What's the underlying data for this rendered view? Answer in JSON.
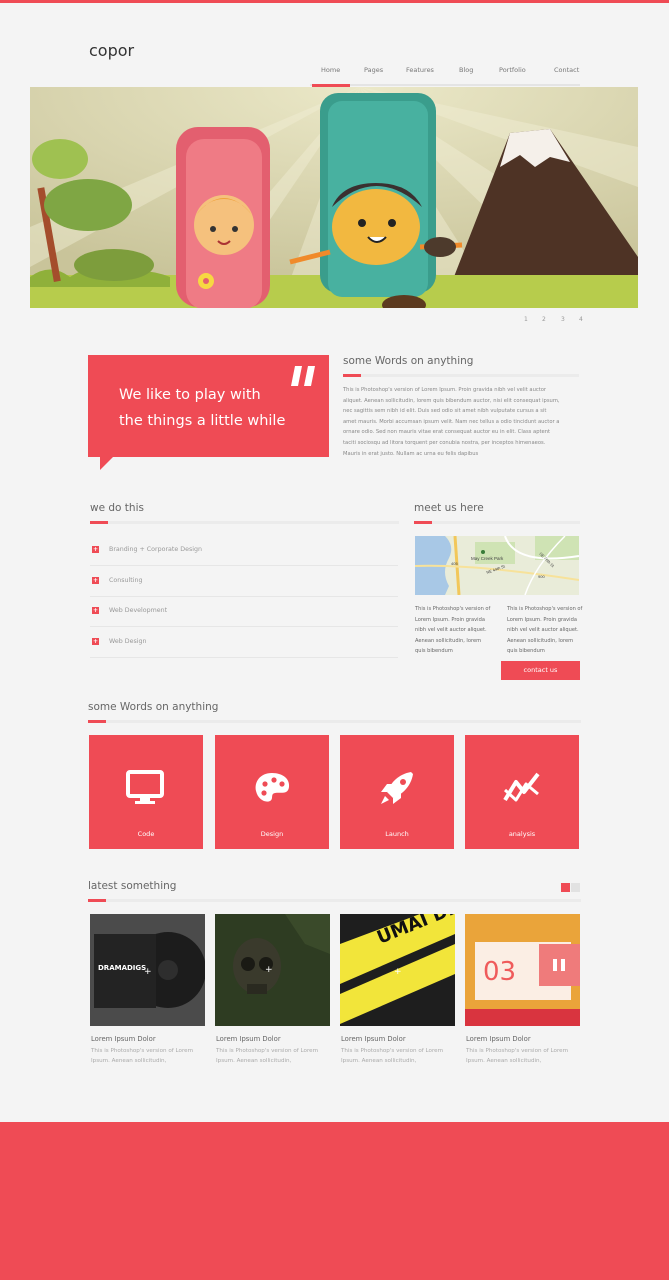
{
  "site": {
    "logo": "copor"
  },
  "nav": {
    "items": [
      "Home",
      "Pages",
      "Features",
      "Blog",
      "Portfolio",
      "Contact"
    ]
  },
  "hero": {
    "pager": [
      "1",
      "2",
      "3",
      "4"
    ]
  },
  "quote": {
    "line1": "We like to play with",
    "line2": "the things a little while"
  },
  "about": {
    "title": "some Words on anything",
    "text": "This is Photoshop's version  of Lorem Ipsum. Proin gravida nibh vel velit auctor aliquet. Aenean sollicitudin, lorem quis bibendum auctor, nisi elit consequat ipsum, nec sagittis sem nibh id elit. Duis sed odio sit amet nibh vulputate cursus a sit amet mauris. Morbi accumsan ipsum velit. Nam nec tellus a odio tincidunt auctor a ornare odio. Sed non  mauris vitae erat consequat auctor eu in elit. Class aptent taciti sociosqu ad litora torquent per conubia nostra, per inceptos himenaeos. Mauris in erat justo. Nullam ac urna eu felis dapibus"
  },
  "services": {
    "title": "we do this",
    "items": [
      "Branding + Corporate Design",
      "Consulting",
      "Web Development",
      "Web Design"
    ]
  },
  "meet": {
    "title": "meet us here",
    "map_labels": [
      "May Creek Park",
      "900",
      "405",
      "NE 44th St",
      "SE 76th St"
    ],
    "col1": "This is Photoshop's version  of Lorem Ipsum. Proin gravida nibh vel velit auctor aliquet. Aenean sollicitudin, lorem quis bibendum",
    "col2": "This is Photoshop's version  of Lorem Ipsum. Proin gravida nibh vel velit auctor aliquet. Aenean sollicitudin, lorem quis bibendum",
    "button": "contact us"
  },
  "features": {
    "title": "some Words on anything",
    "tiles": [
      {
        "label": "Code",
        "icon": "monitor-icon"
      },
      {
        "label": "Design",
        "icon": "palette-icon"
      },
      {
        "label": "Launch",
        "icon": "rocket-icon"
      },
      {
        "label": "analysis",
        "icon": "chart-icon"
      }
    ]
  },
  "latest": {
    "title": "latest something",
    "items": [
      {
        "title": "Lorem Ipsum Dolor",
        "desc": "This is Photoshop's version  of Lorem Ipsum. Aenean sollicitudin,",
        "image_text": "DRAMADIGS"
      },
      {
        "title": "Lorem Ipsum Dolor",
        "desc": "This is Photoshop's version  of Lorem Ipsum. Aenean sollicitudin,",
        "image_text": ""
      },
      {
        "title": "Lorem Ipsum Dolor",
        "desc": "This is Photoshop's version  of Lorem Ipsum. Aenean sollicitudin,",
        "image_text": "UMAI DR. HOU"
      },
      {
        "title": "Lorem Ipsum Dolor",
        "desc": "This is Photoshop's version  of Lorem Ipsum. Aenean sollicitudin,",
        "image_text": "03"
      }
    ]
  },
  "colors": {
    "accent": "#ef4b55",
    "background": "#f4f4f4"
  }
}
